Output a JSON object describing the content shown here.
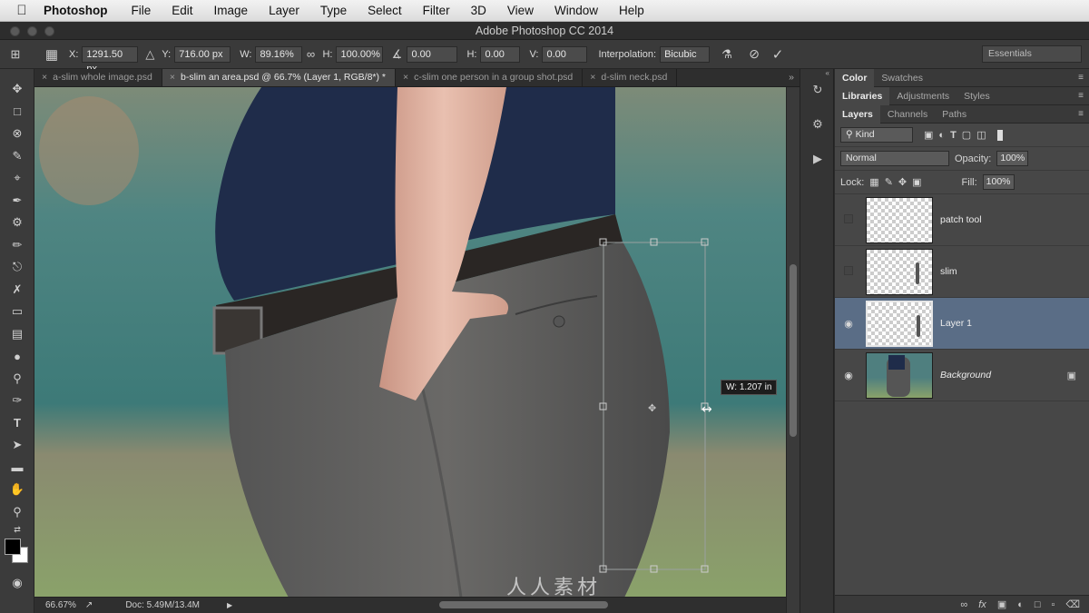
{
  "menubar": {
    "app_name": "Photoshop",
    "items": [
      "File",
      "Edit",
      "Image",
      "Layer",
      "Type",
      "Select",
      "Filter",
      "3D",
      "View",
      "Window",
      "Help"
    ]
  },
  "window": {
    "title": "Adobe Photoshop CC 2014"
  },
  "options_bar": {
    "x_label": "X:",
    "x_value": "1291.50 px",
    "y_label": "Y:",
    "y_value": "716.00 px",
    "w_label": "W:",
    "w_value": "89.16%",
    "h_label": "H:",
    "h_value": "100.00%",
    "angle_value": "0.00",
    "h_skew_label": "H:",
    "h_skew_value": "0.00",
    "v_skew_label": "V:",
    "v_skew_value": "0.00",
    "interp_label": "Interpolation:",
    "interp_value": "Bicubic",
    "workspace": "Essentials"
  },
  "tabs": [
    {
      "label": "a-slim whole image.psd",
      "active": false
    },
    {
      "label": "b-slim an area.psd @ 66.7% (Layer 1, RGB/8*) *",
      "active": true
    },
    {
      "label": "c-slim one person in a group shot.psd",
      "active": false
    },
    {
      "label": "d-slim neck.psd",
      "active": false
    }
  ],
  "canvas": {
    "tooltip": "W: 1.207 in",
    "watermark": "人人素材"
  },
  "status": {
    "zoom": "66.67%",
    "doc": "Doc: 5.49M/13.4M"
  },
  "panels": {
    "top_tabs": [
      "Color",
      "Swatches"
    ],
    "mid_tabs": [
      "Libraries",
      "Adjustments",
      "Styles"
    ],
    "layer_tabs": [
      "Layers",
      "Channels",
      "Paths"
    ],
    "filter_kind": "Kind",
    "blend_mode": "Normal",
    "opacity_label": "Opacity:",
    "opacity_value": "100%",
    "lock_label": "Lock:",
    "fill_label": "Fill:",
    "fill_value": "100%",
    "layers": [
      {
        "name": "patch tool",
        "visible": false,
        "selected": false,
        "italic": false
      },
      {
        "name": "slim",
        "visible": false,
        "selected": false,
        "italic": false
      },
      {
        "name": "Layer 1",
        "visible": true,
        "selected": true,
        "italic": false
      },
      {
        "name": "Background",
        "visible": true,
        "selected": false,
        "italic": true,
        "locked": true
      }
    ]
  },
  "colors": {
    "selection": "#5a6d86",
    "panel": "#474747",
    "accent": "#ffffff"
  }
}
